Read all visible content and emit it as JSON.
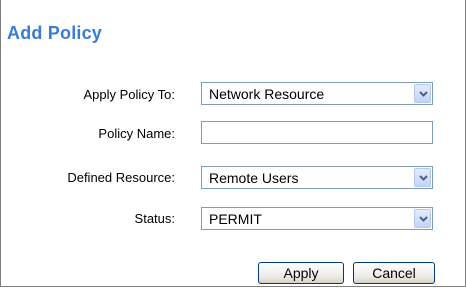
{
  "dialog": {
    "title": "Add Policy"
  },
  "form": {
    "apply_policy_to": {
      "label": "Apply Policy To:",
      "value": "Network Resource"
    },
    "policy_name": {
      "label": "Policy Name:",
      "value": ""
    },
    "defined_resource": {
      "label": "Defined Resource:",
      "value": "Remote Users"
    },
    "status": {
      "label": "Status:",
      "value": "PERMIT"
    }
  },
  "buttons": {
    "apply": "Apply",
    "cancel": "Cancel"
  },
  "colors": {
    "title": "#3a7bd5",
    "field_border": "#7f9db9",
    "button_border": "#003c74"
  },
  "icons": {
    "dropdown": "chevron-down-icon"
  }
}
